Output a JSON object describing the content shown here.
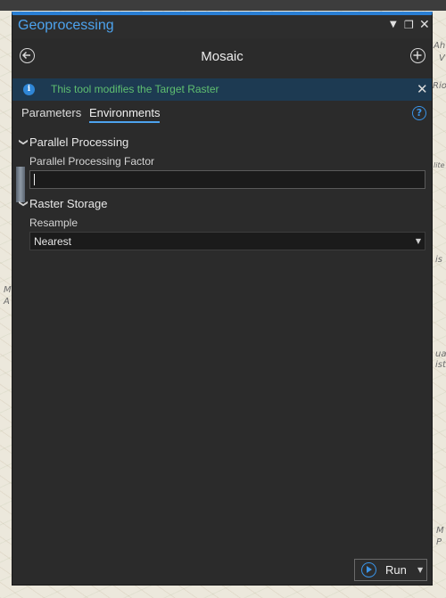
{
  "pane": {
    "title": "Geoprocessing",
    "tool_title": "Mosaic",
    "message": "This tool modifies the Target Raster",
    "tabs": [
      "Parameters",
      "Environments"
    ],
    "active_tab": "Environments"
  },
  "sections": {
    "parallel": {
      "title": "Parallel Processing",
      "field_label": "Parallel Processing Factor",
      "field_value": ""
    },
    "raster": {
      "title": "Raster Storage",
      "field_label": "Resample",
      "field_value": "Nearest"
    }
  },
  "footer": {
    "run_label": "Run"
  },
  "map_labels": [
    "Ah",
    "V",
    "Rio",
    "lite",
    "is",
    "M",
    "A",
    "ua",
    "ist",
    "M",
    "P"
  ],
  "colors": {
    "accent": "#2a7fd4",
    "message_text": "#5fbf70",
    "message_bg": "#1d3a52",
    "pane_bg": "#2b2b2b"
  }
}
